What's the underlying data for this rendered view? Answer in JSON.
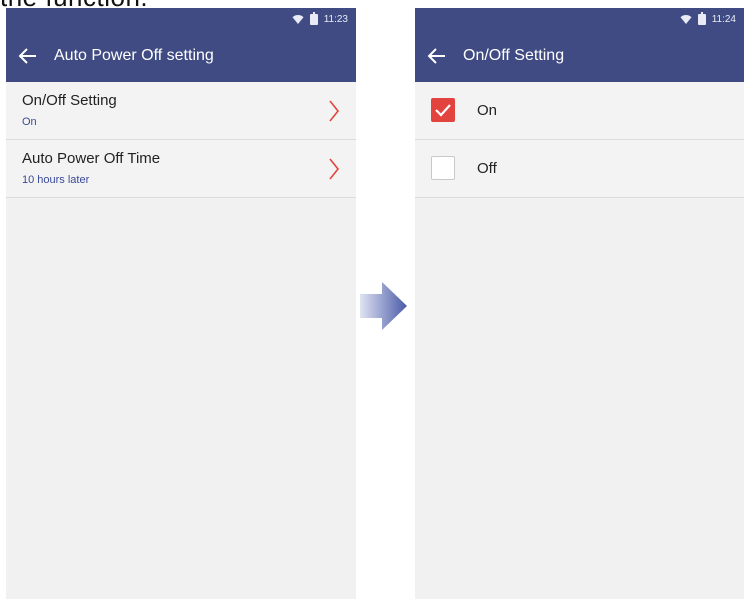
{
  "caption": "the function.",
  "left_screen": {
    "status_time": "11:23",
    "title": "Auto Power Off setting",
    "items": [
      {
        "title": "On/Off Setting",
        "value": "On"
      },
      {
        "title": "Auto Power Off Time",
        "value": "10 hours later"
      }
    ]
  },
  "right_screen": {
    "status_time": "11:24",
    "title": "On/Off Setting",
    "options": [
      {
        "label": "On",
        "checked": true
      },
      {
        "label": "Off",
        "checked": false
      }
    ]
  },
  "colors": {
    "appbar": "#3f4b82",
    "accent_red": "#e2433f",
    "subtext_blue": "#3a4a96",
    "arrow_gradient_start": "#dfe3f2",
    "arrow_gradient_end": "#4a5aa8"
  },
  "icons": [
    "wifi-icon",
    "battery-icon",
    "back-arrow-icon",
    "chevron-right-icon",
    "checkmark-icon",
    "transition-arrow-icon"
  ]
}
